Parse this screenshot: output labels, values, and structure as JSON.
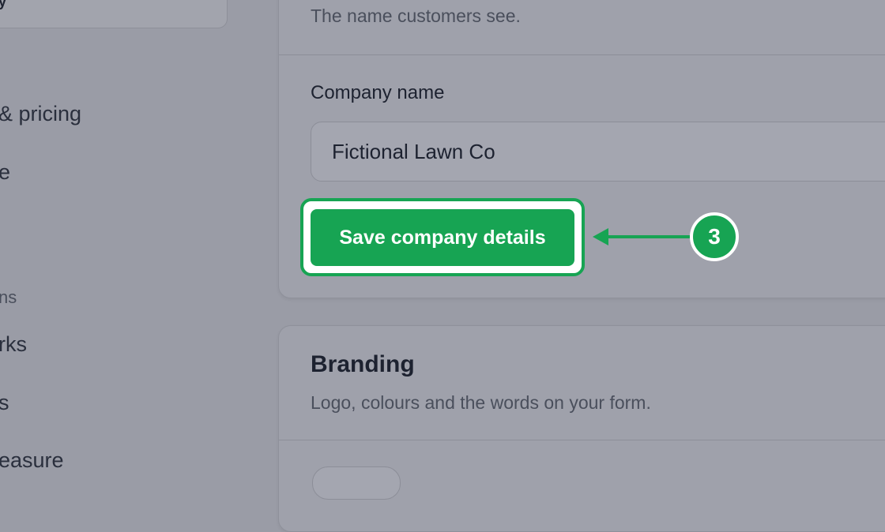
{
  "sidebar": {
    "top_box_text": "y",
    "items": [
      {
        "label": "& pricing"
      },
      {
        "label": "e"
      },
      {
        "label": "rks"
      },
      {
        "label": "s"
      },
      {
        "label": "easure"
      }
    ],
    "section_heading": "ns"
  },
  "company_card": {
    "subtitle": "The name customers see.",
    "field_label": "Company name",
    "field_value": "Fictional Lawn Co",
    "save_label": "Save company details"
  },
  "branding_card": {
    "title": "Branding",
    "subtitle": "Logo, colours and the words on your form."
  },
  "annotation": {
    "step_number": "3",
    "color": "#17a453"
  },
  "colors": {
    "accent": "#17a453",
    "overlay_bg": "#9a9ca6"
  }
}
